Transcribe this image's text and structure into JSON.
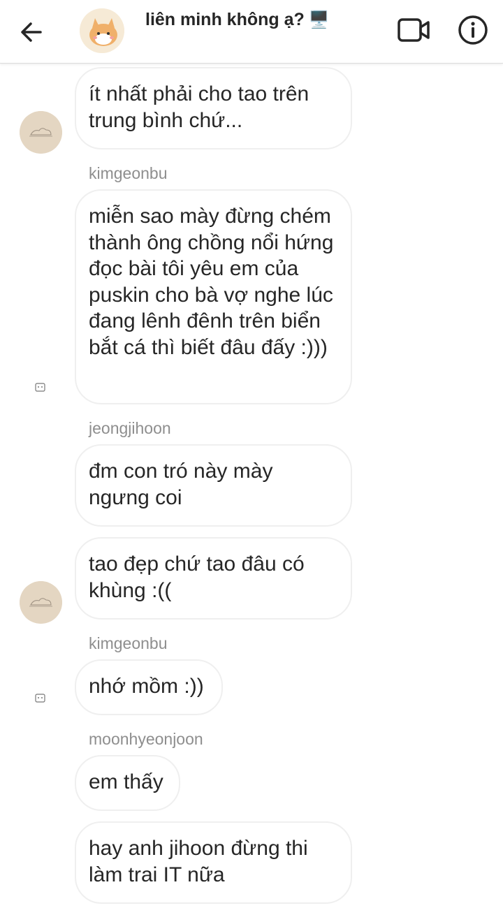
{
  "header": {
    "title": "liên minh không ạ?",
    "title_emoji": "🖥️",
    "back_icon": "arrow-left-icon",
    "video_icon": "video-camera-icon",
    "info_icon": "info-icon",
    "avatar": "group-avatar-cat"
  },
  "messages": [
    {
      "text": "ít nhất phải cho tao trên trung bình chứ..."
    },
    {
      "sender": "kimgeonbu",
      "text": "miễn sao mày đừng chém thành ông chồng nổi hứng đọc bài tôi yêu em của puskin cho bà vợ nghe lúc đang lênh đênh trên biển bắt cá thì biết đâu đấy :)))"
    },
    {
      "sender": "jeongjihoon",
      "text": "đm con tró này mày ngưng coi"
    },
    {
      "text": "tao đẹp chứ tao đâu có khùng :(("
    },
    {
      "sender": "kimgeonbu",
      "text": "nhớ mồm :))"
    },
    {
      "sender": "moonhyeonjoon",
      "text": "em thấy"
    },
    {
      "text": "hay anh jihoon đừng thi làm trai IT nữa"
    }
  ],
  "colors": {
    "text": "#262626",
    "sender": "#8e8e8e",
    "bubble_border": "#efefef",
    "avatar_bg": "#e4d6c2"
  }
}
